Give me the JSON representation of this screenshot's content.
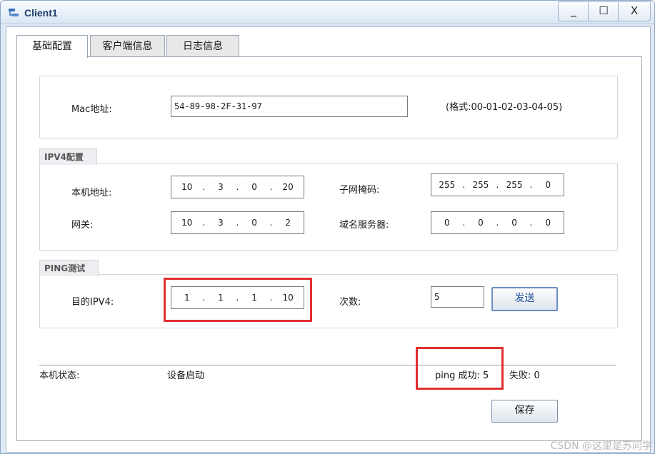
{
  "window": {
    "title": "Client1",
    "minimize": "_",
    "maximize": "☐",
    "close": "X"
  },
  "tabs": [
    "基础配置",
    "客户端信息",
    "日志信息"
  ],
  "mac": {
    "label": "Mac地址:",
    "value": "54-89-98-2F-31-97",
    "format_hint": "(格式:00-01-02-03-04-05)"
  },
  "ipv4": {
    "legend": "IPV4配置",
    "local_ip": {
      "label": "本机地址:",
      "octets": [
        "10",
        "3",
        "0",
        "20"
      ]
    },
    "subnet_mask": {
      "label": "子网掩码:",
      "octets": [
        "255",
        "255",
        "255",
        "0"
      ]
    },
    "gateway": {
      "label": "网关:",
      "octets": [
        "10",
        "3",
        "0",
        "2"
      ]
    },
    "dns": {
      "label": "域名服务器:",
      "octets": [
        "0",
        "0",
        "0",
        "0"
      ]
    }
  },
  "ping": {
    "legend": "PING测试",
    "target_label": "目的IPV4:",
    "target_octets": [
      "1",
      "1",
      "1",
      "10"
    ],
    "count_label": "次数:",
    "count_value": "5",
    "send_label": "发送"
  },
  "status": {
    "label": "本机状态:",
    "value": "设备启动",
    "ping_success": "ping 成功: 5",
    "fail": "失败: 0"
  },
  "save_label": "保存",
  "watermark": "CSDN @这里是苏同学"
}
